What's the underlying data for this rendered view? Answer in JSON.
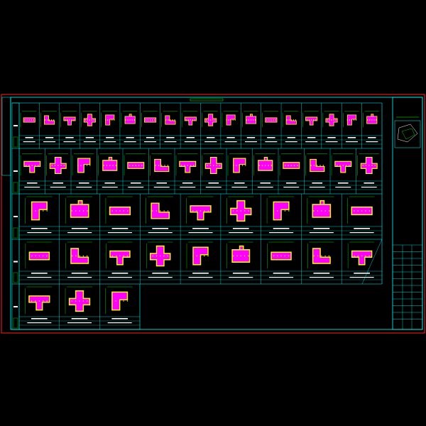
{
  "drawing": {
    "colors": {
      "background": "#000000",
      "border": "#ff2020",
      "frame": "#00ffff",
      "section_fill": "#ff00ff",
      "rebar": "#ffff00",
      "dim_line": "#00ff00",
      "text": "#ffffff"
    },
    "title_block": {
      "items": [
        "",
        "",
        "",
        "",
        "",
        "",
        "",
        ""
      ]
    }
  }
}
